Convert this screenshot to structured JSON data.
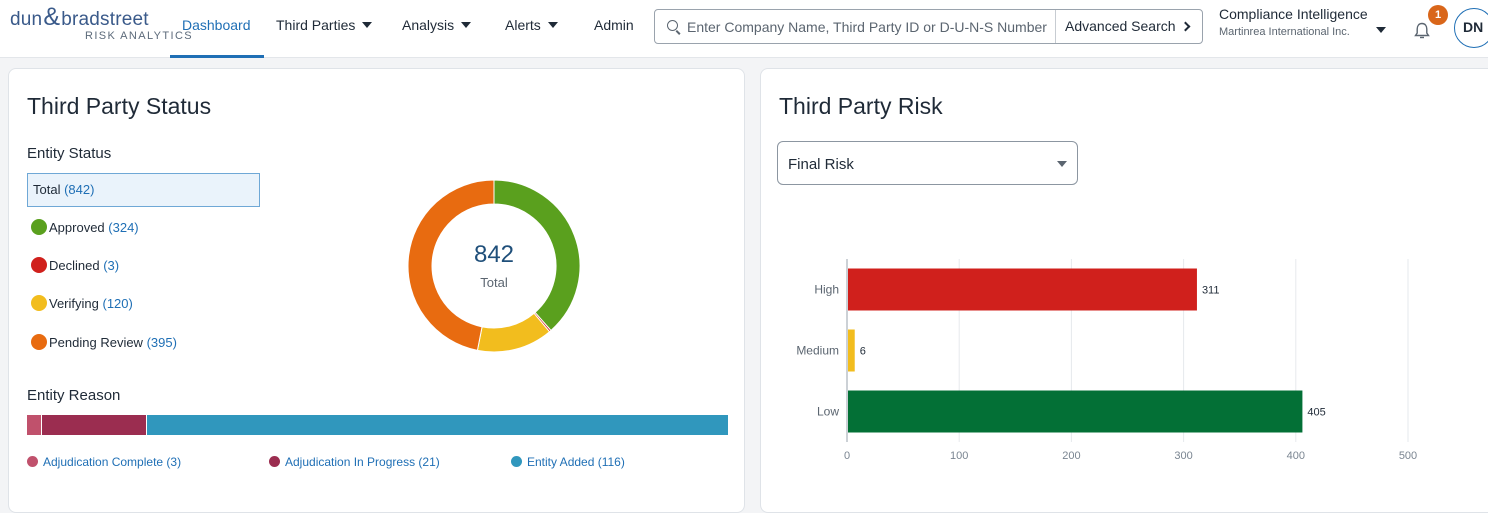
{
  "brand": {
    "name_left": "dun",
    "amp": "&",
    "name_right": "bradstreet",
    "sub": "RISK ANALYTICS"
  },
  "nav": {
    "dashboard": "Dashboard",
    "third_parties": "Third Parties",
    "analysis": "Analysis",
    "alerts": "Alerts",
    "admin": "Admin"
  },
  "search": {
    "placeholder": "Enter Company Name, Third Party ID or D-U-N-S Number",
    "advanced_label": "Advanced Search"
  },
  "org": {
    "product": "Compliance Intelligence",
    "company": "Martinrea International Inc."
  },
  "notifications": {
    "count": "1"
  },
  "user": {
    "initials": "DN"
  },
  "colors": {
    "accent": "#1f6fb5",
    "approved": "#5aa01e",
    "declined": "#d0201c",
    "verifying": "#f2bd1e",
    "pending": "#e86b10",
    "adjudication_complete": "#c0516c",
    "adjudication_in_progress": "#9b2d50",
    "entity_added": "#3097bd",
    "risk_high": "#d0201c",
    "risk_medium": "#f2bd1e",
    "risk_low": "#037036"
  },
  "status_card": {
    "title": "Third Party Status",
    "entity_status_heading": "Entity Status",
    "total_label": "Total",
    "total_count": "(842)",
    "items": [
      {
        "label": "Approved",
        "count": "(324)",
        "value": 324
      },
      {
        "label": "Declined",
        "count": "(3)",
        "value": 3
      },
      {
        "label": "Verifying",
        "count": "(120)",
        "value": 120
      },
      {
        "label": "Pending Review",
        "count": "(395)",
        "value": 395
      }
    ],
    "donut_center_value": "842",
    "donut_center_label": "Total",
    "entity_reason_heading": "Entity Reason",
    "reasons": [
      {
        "label": "Adjudication Complete (3)",
        "value": 3
      },
      {
        "label": "Adjudication In Progress (21)",
        "value": 21
      },
      {
        "label": "Entity Added (116)",
        "value": 116
      }
    ]
  },
  "risk_card": {
    "title": "Third Party Risk",
    "selected": "Final Risk"
  },
  "chart_data": {
    "type": "bar",
    "orientation": "horizontal",
    "categories": [
      "High",
      "Medium",
      "Low"
    ],
    "values": [
      311,
      6,
      405
    ],
    "xlim": [
      0,
      500
    ],
    "xticks": [
      0,
      100,
      200,
      300,
      400,
      500
    ],
    "grid": true
  }
}
